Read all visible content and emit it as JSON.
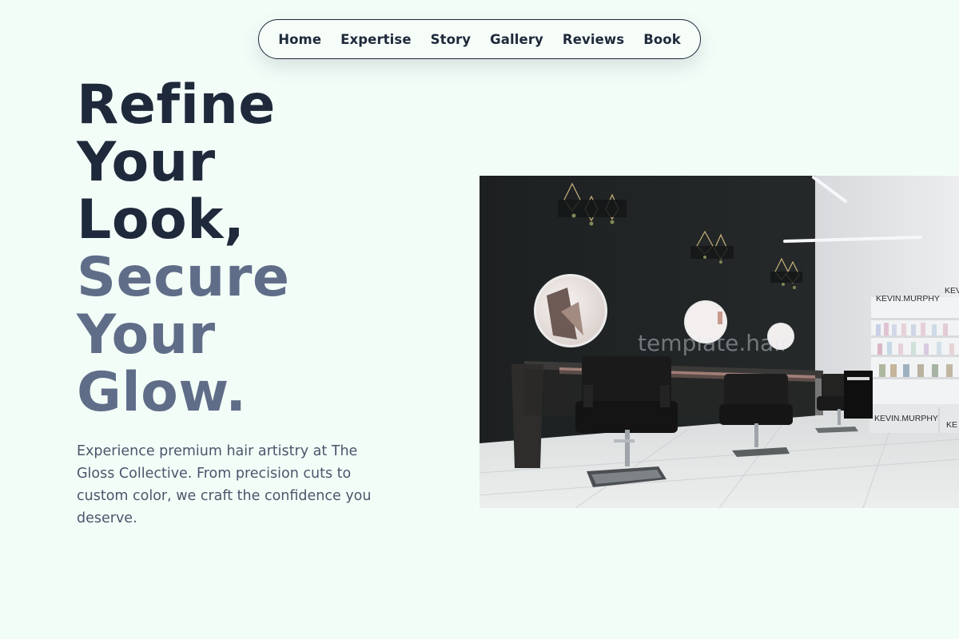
{
  "nav": {
    "items": [
      "Home",
      "Expertise",
      "Story",
      "Gallery",
      "Reviews",
      "Book"
    ]
  },
  "hero": {
    "title_lines_dark": [
      "Refine",
      "Your",
      "Look,"
    ],
    "title_lines_muted": [
      "Secure",
      "Your",
      "Glow."
    ],
    "description": "Experience premium hair artistry at The Gloss Collective. From precision cuts to custom color, we craft the confidence you deserve.",
    "image": {
      "watermark": "template.hair",
      "shelf_sign_top": "KEVIN.MURPHY",
      "shelf_sign_side": "KEV",
      "shelf_sign_bottom": "KEVIN.MURPHY",
      "shelf_sign_bottom_side": "KE"
    }
  },
  "colors": {
    "background": "#f3fdf8",
    "heading_dark": "#1e293b",
    "heading_muted": "#5f6d88",
    "body_text": "#4a566b"
  }
}
